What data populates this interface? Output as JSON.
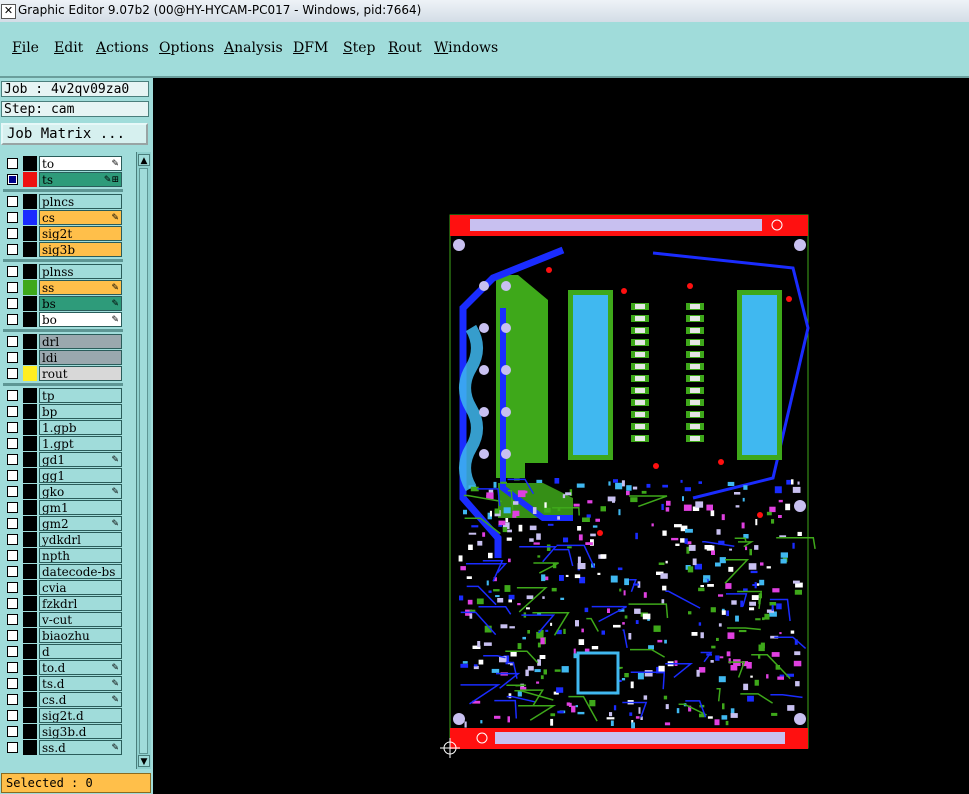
{
  "window": {
    "title": "Graphic Editor 9.07b2 (00@HY-HYCAM-PC017 - Windows, pid:7664)",
    "icon": "app-icon"
  },
  "menu": [
    "File",
    "Edit",
    "Actions",
    "Options",
    "Analysis",
    "DFM",
    "Step",
    "Rout",
    "Windows"
  ],
  "panel": {
    "job_line": "Job : 4v2qv09za0",
    "step_line": "Step: cam",
    "job_matrix_label": "Job Matrix ...",
    "selected_line": "Selected : 0"
  },
  "layers": [
    {
      "name": "to",
      "checked": false,
      "swatch": "#000000",
      "bg": "#ffffff",
      "mark": "✎"
    },
    {
      "name": "ts",
      "checked": true,
      "swatch": "#ee1111",
      "bg": "#2e9b7a",
      "mark": "✎⊞"
    },
    {
      "name": "plncs",
      "checked": false,
      "swatch": "#000000",
      "bg": "#a0dcda",
      "mark": ""
    },
    {
      "name": "cs",
      "checked": false,
      "swatch": "#1a2cff",
      "bg": "#ffbf4a",
      "mark": "✎"
    },
    {
      "name": "sig2t",
      "checked": false,
      "swatch": "#000000",
      "bg": "#ffbf4a",
      "mark": ""
    },
    {
      "name": "sig3b",
      "checked": false,
      "swatch": "#000000",
      "bg": "#ffbf4a",
      "mark": ""
    },
    {
      "name": "plnss",
      "checked": false,
      "swatch": "#000000",
      "bg": "#a0dcda",
      "mark": ""
    },
    {
      "name": "ss",
      "checked": false,
      "swatch": "#3ea81a",
      "bg": "#ffbf4a",
      "mark": "✎"
    },
    {
      "name": "bs",
      "checked": false,
      "swatch": "#000000",
      "bg": "#2e9b7a",
      "mark": "✎"
    },
    {
      "name": "bo",
      "checked": false,
      "swatch": "#000000",
      "bg": "#ffffff",
      "mark": "✎"
    },
    {
      "name": "drl",
      "checked": false,
      "swatch": "#000000",
      "bg": "#9aa8ae",
      "mark": ""
    },
    {
      "name": "ldi",
      "checked": false,
      "swatch": "#000000",
      "bg": "#9aa8ae",
      "mark": ""
    },
    {
      "name": "rout",
      "checked": false,
      "swatch": "#ffee22",
      "bg": "#d8d8d8",
      "mark": ""
    },
    {
      "name": "tp",
      "checked": false,
      "swatch": "#000000",
      "bg": "#a0dcda",
      "mark": ""
    },
    {
      "name": "bp",
      "checked": false,
      "swatch": "#000000",
      "bg": "#a0dcda",
      "mark": ""
    },
    {
      "name": "1.gpb",
      "checked": false,
      "swatch": "#000000",
      "bg": "#a0dcda",
      "mark": ""
    },
    {
      "name": "1.gpt",
      "checked": false,
      "swatch": "#000000",
      "bg": "#a0dcda",
      "mark": ""
    },
    {
      "name": "gd1",
      "checked": false,
      "swatch": "#000000",
      "bg": "#a0dcda",
      "mark": "✎"
    },
    {
      "name": "gg1",
      "checked": false,
      "swatch": "#000000",
      "bg": "#a0dcda",
      "mark": ""
    },
    {
      "name": "gko",
      "checked": false,
      "swatch": "#000000",
      "bg": "#a0dcda",
      "mark": "✎"
    },
    {
      "name": "gm1",
      "checked": false,
      "swatch": "#000000",
      "bg": "#a0dcda",
      "mark": ""
    },
    {
      "name": "gm2",
      "checked": false,
      "swatch": "#000000",
      "bg": "#a0dcda",
      "mark": "✎"
    },
    {
      "name": "ydkdrl",
      "checked": false,
      "swatch": "#000000",
      "bg": "#a0dcda",
      "mark": ""
    },
    {
      "name": "npth",
      "checked": false,
      "swatch": "#000000",
      "bg": "#a0dcda",
      "mark": ""
    },
    {
      "name": "datecode-bs",
      "checked": false,
      "swatch": "#000000",
      "bg": "#a0dcda",
      "mark": ""
    },
    {
      "name": "cvia",
      "checked": false,
      "swatch": "#000000",
      "bg": "#a0dcda",
      "mark": ""
    },
    {
      "name": "fzkdrl",
      "checked": false,
      "swatch": "#000000",
      "bg": "#a0dcda",
      "mark": ""
    },
    {
      "name": "v-cut",
      "checked": false,
      "swatch": "#000000",
      "bg": "#a0dcda",
      "mark": ""
    },
    {
      "name": "biaozhu",
      "checked": false,
      "swatch": "#000000",
      "bg": "#a0dcda",
      "mark": ""
    },
    {
      "name": "d",
      "checked": false,
      "swatch": "#000000",
      "bg": "#a0dcda",
      "mark": ""
    },
    {
      "name": "to.d",
      "checked": false,
      "swatch": "#000000",
      "bg": "#a0dcda",
      "mark": "✎"
    },
    {
      "name": "ts.d",
      "checked": false,
      "swatch": "#000000",
      "bg": "#a0dcda",
      "mark": "✎"
    },
    {
      "name": "cs.d",
      "checked": false,
      "swatch": "#000000",
      "bg": "#a0dcda",
      "mark": "✎"
    },
    {
      "name": "sig2t.d",
      "checked": false,
      "swatch": "#000000",
      "bg": "#a0dcda",
      "mark": ""
    },
    {
      "name": "sig3b.d",
      "checked": false,
      "swatch": "#000000",
      "bg": "#a0dcda",
      "mark": ""
    },
    {
      "name": "ss.d",
      "checked": false,
      "swatch": "#000000",
      "bg": "#a0dcda",
      "mark": "✎"
    }
  ],
  "colors": {
    "panel_bg": "#a0dcda",
    "canvas_bg": "#000000",
    "board_red": "#ff1010",
    "board_green": "#3ea81a",
    "trace_blue": "#1a2cff",
    "pad_cyan": "#40b8f0",
    "pad_lavender": "#c8c0f0",
    "component_magenta": "#e040e0"
  },
  "scrollbar": {
    "up_icon": "scroll-up-arrow",
    "down_icon": "scroll-down-arrow"
  }
}
